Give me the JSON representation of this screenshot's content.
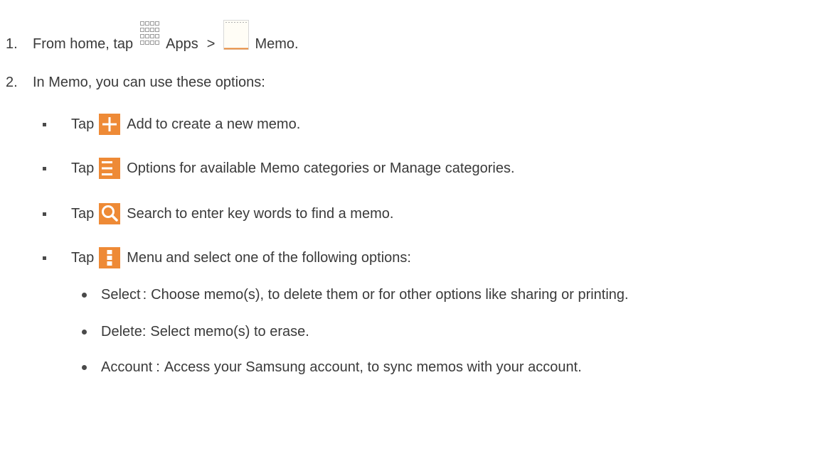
{
  "step1": {
    "number": "1.",
    "text_before": "From home, tap",
    "apps_label": "Apps",
    "separator": ">",
    "memo_label": "Memo",
    "period": "."
  },
  "step2": {
    "number": "2.",
    "text": "In Memo, you can use these options:"
  },
  "options": [
    {
      "tap": "Tap",
      "icon": "add-icon",
      "label": "Add",
      "desc": "to create a new memo."
    },
    {
      "tap": "Tap",
      "icon": "options-icon",
      "label": "Options",
      "desc": "for available Memo categories or Manage categories."
    },
    {
      "tap": "Tap",
      "icon": "search-icon",
      "label": "Search",
      "desc": "to enter key words to find a memo."
    },
    {
      "tap": "Tap",
      "icon": "menu-icon",
      "label": "Menu",
      "desc": "and select one of the following options:"
    }
  ],
  "menu_options": [
    {
      "label": "Select",
      "sep": ":",
      "desc": "Choose memo(s), to delete them or for other options like sharing or printing."
    },
    {
      "label": "Delete",
      "sep": ":",
      "desc": "Select memo(s) to erase."
    },
    {
      "label": "Account",
      "sep": ":",
      "desc": "Access your Samsung account, to sync memos with your account."
    }
  ],
  "colors": {
    "text": "#3a3a3a",
    "icon_accent": "#ee8a36"
  }
}
